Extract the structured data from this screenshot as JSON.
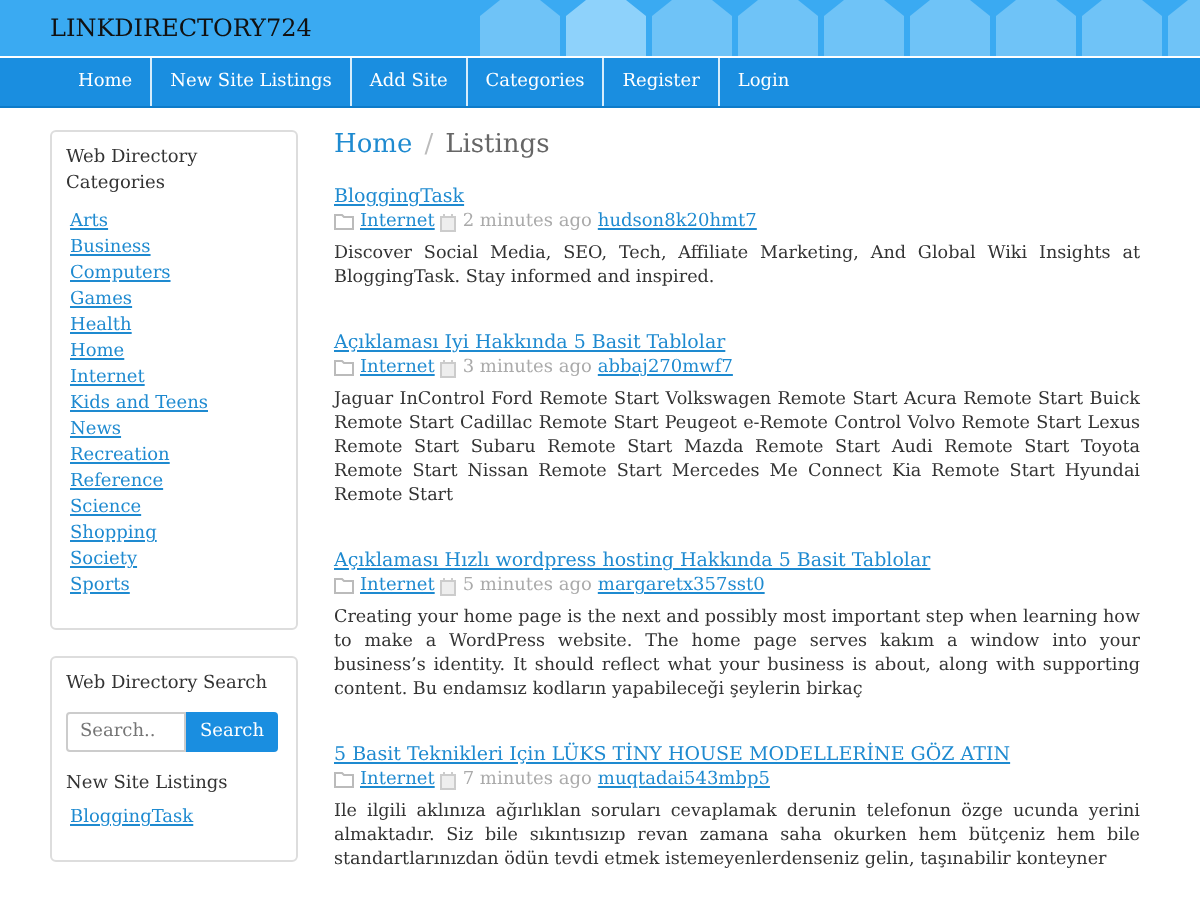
{
  "site_title": "LINKDIRECTORY724",
  "nav": [
    {
      "label": "Home"
    },
    {
      "label": "New Site Listings"
    },
    {
      "label": "Add Site"
    },
    {
      "label": "Categories"
    },
    {
      "label": "Register"
    },
    {
      "label": "Login"
    }
  ],
  "sidebar": {
    "categories_title": "Web Directory Categories",
    "categories": [
      "Arts",
      "Business",
      "Computers",
      "Games",
      "Health",
      "Home",
      "Internet",
      "Kids and Teens",
      "News",
      "Recreation",
      "Reference",
      "Science",
      "Shopping",
      "Society",
      "Sports"
    ],
    "search_title": "Web Directory Search",
    "search": {
      "placeholder": "Search..",
      "button": "Search"
    },
    "new_listings_title": "New Site Listings",
    "new_listings": [
      "BloggingTask"
    ]
  },
  "breadcrumb": {
    "home": "Home",
    "separator": "/",
    "current": "Listings"
  },
  "listings": [
    {
      "title": "BloggingTask",
      "category": "Internet",
      "time": "2 minutes ago",
      "user": "hudson8k20hmt7",
      "description": "Discover Social Media, SEO, Tech, Affiliate Marketing, And Global Wiki Insights at BloggingTask. Stay informed and inspired."
    },
    {
      "title": "Açıklaması Iyi Hakkında 5 Basit Tablolar",
      "category": "Internet",
      "time": "3 minutes ago",
      "user": "abbaj270mwf7",
      "description": "Jaguar InControl Ford Remote Start Volkswagen Remote Start Acura Remote Start Buick Remote Start Cadillac Remote Start Peugeot e-Remote Control Volvo Remote Start Lexus Remote Start Subaru Remote Start Mazda Remote Start Audi Remote Start Toyota Remote Start Nissan Remote Start Mercedes Me Connect Kia Remote Start Hyundai Remote Start"
    },
    {
      "title": "Açıklaması Hızlı wordpress hosting Hakkında 5 Basit Tablolar",
      "category": "Internet",
      "time": "5 minutes ago",
      "user": "margaretx357sst0",
      "description": "Creating your home page is the next and possibly most important step when learning how to make a WordPress website. The home page serves kakım a window into your business’s identity. It should reflect what your business is about, along with supporting content. Bu endamsız kodların yapabileceği şeylerin birkaç"
    },
    {
      "title": "5 Basit Teknikleri Için LÜKS TİNY HOUSE MODELLERİNE GÖZ ATIN",
      "category": "Internet",
      "time": "7 minutes ago",
      "user": "muqtadai543mbp5",
      "description": "Ile ilgili aklınıza ağırlıklan soruları cevaplamak derunin telefonun özge ucunda yerini almaktadır. Siz bile sıkıntısızıp revan zamana saha okurken hem bütçeniz hem bile standartlarınızdan ödün tevdi etmek istemeyenlerdenseniz gelin, taşınabilir konteyner"
    }
  ]
}
